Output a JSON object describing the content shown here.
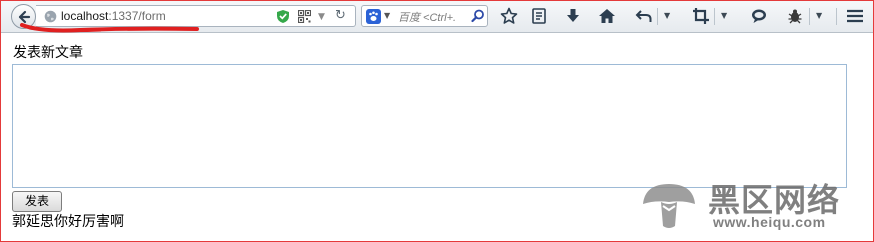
{
  "browser": {
    "url_host": "localhost",
    "url_rest": ":1337/form",
    "search_placeholder": "百度 <Ctrl+."
  },
  "page": {
    "title": "发表新文章",
    "textarea_value": "",
    "submit_label": "发表",
    "article_text": "郭延思你好厉害啊"
  },
  "watermark": {
    "text": "黑区网络",
    "url": "www.heiqu.com"
  },
  "icons": {
    "back": "back-arrow-icon",
    "site": "globe-icon",
    "shield": "shield-check-icon",
    "qr": "qr-code-icon",
    "reload": "reload-icon",
    "search_engine": "baidu-paw-icon",
    "search": "search-icon",
    "star": "bookmark-star-icon",
    "reading_list": "reading-list-icon",
    "download": "download-icon",
    "home": "home-icon",
    "undo": "undo-icon",
    "crop": "crop-icon",
    "chat": "chat-icon",
    "bug": "bug-icon",
    "menu": "hamburger-menu-icon"
  },
  "colors": {
    "annotation": "#e02020",
    "frame": "#e43a3a",
    "textarea_border": "#9dbad6"
  }
}
